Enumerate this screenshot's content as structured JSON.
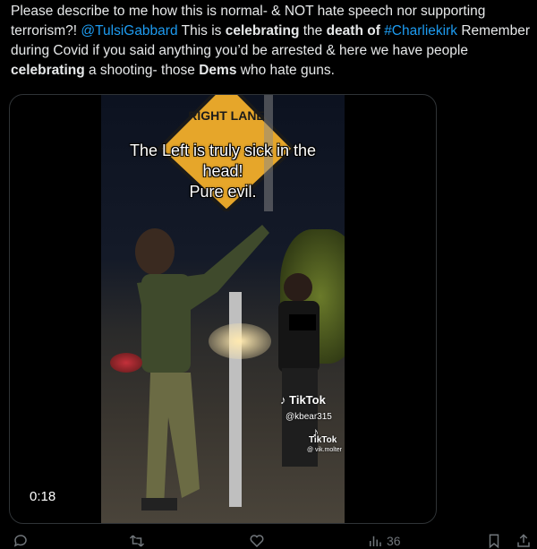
{
  "tweet": {
    "segments": [
      {
        "text": "Please describe to me how this is normal- & NOT hate speech nor supporting terrorism?! ",
        "style": "plain"
      },
      {
        "text": "@TulsiGabbard",
        "style": "mention"
      },
      {
        "text": " This is ",
        "style": "plain"
      },
      {
        "text": "celebrating",
        "style": "bold"
      },
      {
        "text": " the ",
        "style": "plain"
      },
      {
        "text": "death of",
        "style": "bold"
      },
      {
        "text": " ",
        "style": "plain"
      },
      {
        "text": "#Charliekirk",
        "style": "mention"
      },
      {
        "text": " Remember during Covid if you said anything you’d be arrested & here we have people ",
        "style": "plain"
      },
      {
        "text": "celebrating",
        "style": "bold"
      },
      {
        "text": " a shooting- those ",
        "style": "plain"
      },
      {
        "text": "Dems",
        "style": "bold"
      },
      {
        "text": " who hate guns.",
        "style": "plain"
      }
    ]
  },
  "video": {
    "sign_text": "RIGHT LANE",
    "caption_line1": "The Left is truly sick in the",
    "caption_line2": "head!",
    "caption_line3": "Pure evil.",
    "tiktok_label": "TikTok",
    "tiktok_handle": "@kbear315",
    "tiktok_label2": "TikTok",
    "tiktok_handle2": "@ vik.molter",
    "duration": "0:18"
  },
  "actions": {
    "reply_icon": "reply-icon",
    "retweet_icon": "retweet-icon",
    "like_icon": "like-icon",
    "views_icon": "views-icon",
    "views_count": "36",
    "bookmark_icon": "bookmark-icon",
    "share_icon": "share-icon"
  },
  "colors": {
    "background": "#000000",
    "text": "#e7e9ea",
    "link": "#1d9bf0",
    "muted": "#71767b"
  }
}
